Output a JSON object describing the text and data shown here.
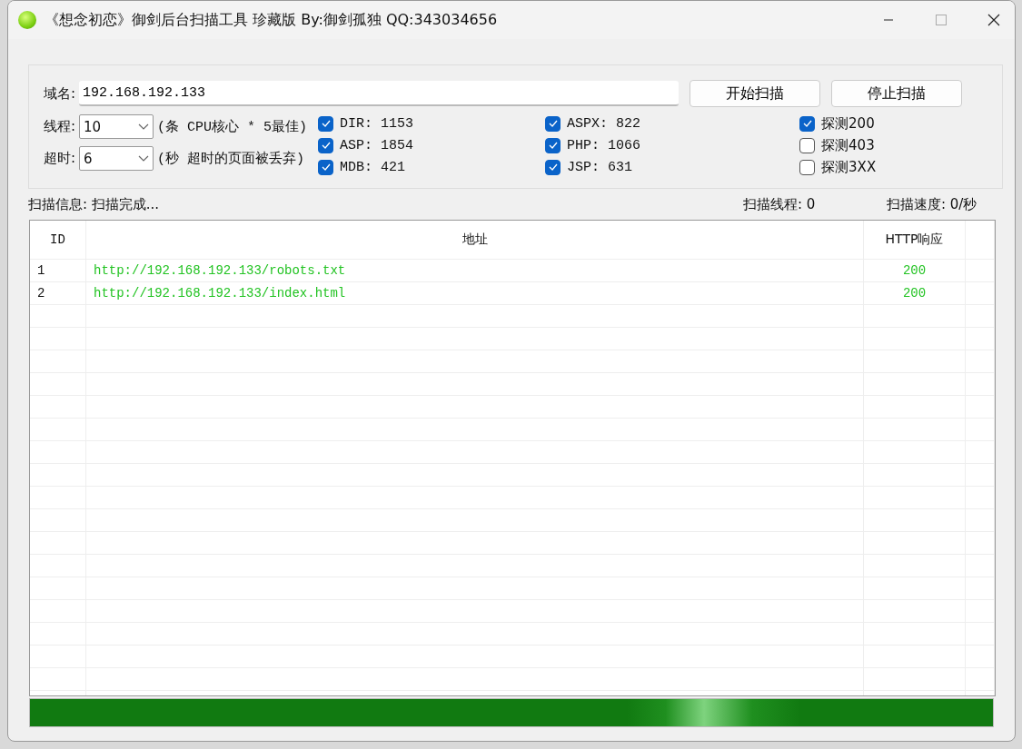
{
  "window": {
    "title": "《想念初恋》御剑后台扫描工具 珍藏版 By:御剑孤独 QQ:343034656"
  },
  "domain": {
    "label": "域名:",
    "value": "192.168.192.133"
  },
  "buttons": [
    {
      "label": "开始扫描"
    },
    {
      "label": "停止扫描"
    }
  ],
  "threads": {
    "label": "线程:",
    "value": "10",
    "hint": "(条 CPU核心 * 5最佳)"
  },
  "timeout": {
    "label": "超时:",
    "value": "6",
    "hint": "(秒 超时的页面被丢弃)"
  },
  "dictionaries": [
    {
      "label": "DIR: 1153",
      "checked": true
    },
    {
      "label": "ASP: 1854",
      "checked": true
    },
    {
      "label": "MDB: 421",
      "checked": true
    },
    {
      "label": "ASPX: 822",
      "checked": true
    },
    {
      "label": "PHP: 1066",
      "checked": true
    },
    {
      "label": "JSP: 631",
      "checked": true
    }
  ],
  "probes": [
    {
      "label": "探测200",
      "checked": true
    },
    {
      "label": "探测403",
      "checked": false
    },
    {
      "label": "探测3XX",
      "checked": false
    }
  ],
  "status": {
    "info": "扫描信息: 扫描完成...",
    "threads": "扫描线程: 0",
    "speed": "扫描速度: 0/秒"
  },
  "table": {
    "columns": [
      "ID",
      "地址",
      "HTTP响应"
    ],
    "rows": [
      [
        "1",
        "http://192.168.192.133/robots.txt",
        "200"
      ],
      [
        "2",
        "http://192.168.192.133/index.html",
        "200"
      ]
    ]
  },
  "progress": {
    "level": 1
  }
}
